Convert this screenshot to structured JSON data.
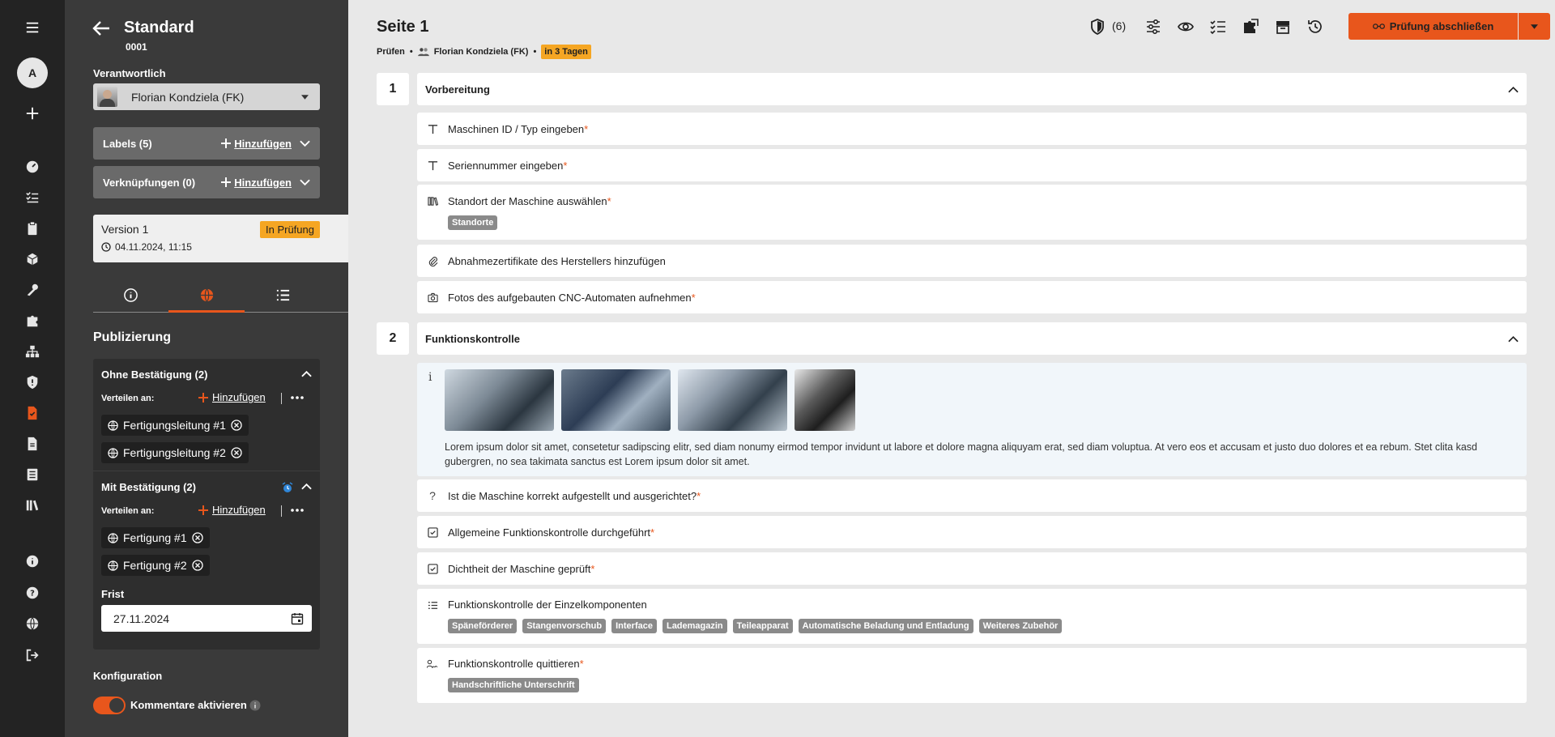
{
  "sidebar_header": {
    "title": "Standard",
    "subtitle": "0001"
  },
  "rail": {
    "avatar_letter": "A"
  },
  "responsible": {
    "label": "Verantwortlich",
    "name": "Florian Kondziela (FK)"
  },
  "labels_bar": {
    "label": "Labels (5)",
    "add": "Hinzufügen"
  },
  "links_bar": {
    "label": "Verknüpfungen (0)",
    "add": "Hinzufügen"
  },
  "version": {
    "name": "Version 1",
    "status": "In Prüfung",
    "date": "04.11.2024, 11:15"
  },
  "publish": {
    "title": "Publizierung",
    "ohne": {
      "title": "Ohne Bestätigung (2)",
      "distribute": "Verteilen an:",
      "add": "Hinzufügen",
      "chips": [
        "Fertigungsleitung #1",
        "Fertigungsleitung #2"
      ]
    },
    "mit": {
      "title": "Mit Bestätigung (2)",
      "distribute": "Verteilen an:",
      "add": "Hinzufügen",
      "chips": [
        "Fertigung #1",
        "Fertigung #2"
      ]
    },
    "deadline_label": "Frist",
    "deadline_value": "27.11.2024"
  },
  "config": {
    "title": "Konfiguration",
    "toggle_label": "Kommentare aktivieren",
    "toggle_on": true
  },
  "page": {
    "title": "Seite 1",
    "meta_mode": "Prüfen",
    "meta_person": "Florian Kondziela (FK)",
    "meta_due": "in 3 Tagen"
  },
  "toolbar": {
    "shield_count": "(6)",
    "finish_label": "Prüfung abschließen"
  },
  "sections": [
    {
      "number": "1",
      "title": "Vorbereitung",
      "items": [
        {
          "icon": "text-icon",
          "label": "Maschinen ID / Typ eingeben",
          "required": "*"
        },
        {
          "icon": "text-icon",
          "label": "Seriennummer eingeben",
          "required": "*"
        },
        {
          "icon": "library-icon",
          "label": "Standort der Maschine auswählen",
          "required": "*",
          "tags": [
            "Standorte"
          ]
        },
        {
          "icon": "paperclip-icon",
          "label": "Abnahmezertifikate des Herstellers hinzufügen"
        },
        {
          "icon": "camera-icon",
          "label": "Fotos des aufgebauten CNC-Automaten aufnehmen",
          "required": "*"
        }
      ]
    },
    {
      "number": "2",
      "title": "Funktionskontrolle",
      "info_text": "Lorem ipsum dolor sit amet, consetetur sadipscing elitr, sed diam nonumy eirmod tempor invidunt ut labore et dolore magna aliquyam erat, sed diam voluptua. At vero eos et accusam et justo duo dolores et ea rebum. Stet clita kasd gubergren, no sea takimata sanctus est Lorem ipsum dolor sit amet.",
      "items": [
        {
          "icon": "question-icon",
          "label": "Ist die Maschine korrekt aufgestellt und ausgerichtet?",
          "required": "*"
        },
        {
          "icon": "checkbox-icon",
          "label": "Allgemeine Funktionskontrolle durchgeführt",
          "required": "*"
        },
        {
          "icon": "checkbox-icon",
          "label": "Dichtheit der Maschine geprüft",
          "required": "*"
        },
        {
          "icon": "checklist-icon",
          "label": "Funktionskontrolle der Einzelkomponenten",
          "tags": [
            "Späneförderer",
            "Stangenvorschub",
            "Interface",
            "Lademagazin",
            "Teileapparat",
            "Automatische Beladung und Entladung",
            "Weiteres Zubehör"
          ]
        },
        {
          "icon": "signature-icon",
          "label": "Funktionskontrolle quittieren",
          "required": "*",
          "tags": [
            "Handschriftliche Unterschrift"
          ]
        }
      ]
    }
  ],
  "colors": {
    "accent": "#e8561c",
    "badge": "#f5a623",
    "rail": "#232323",
    "sidebar": "#3a3a3a",
    "info_bg": "#f1f6fa"
  }
}
